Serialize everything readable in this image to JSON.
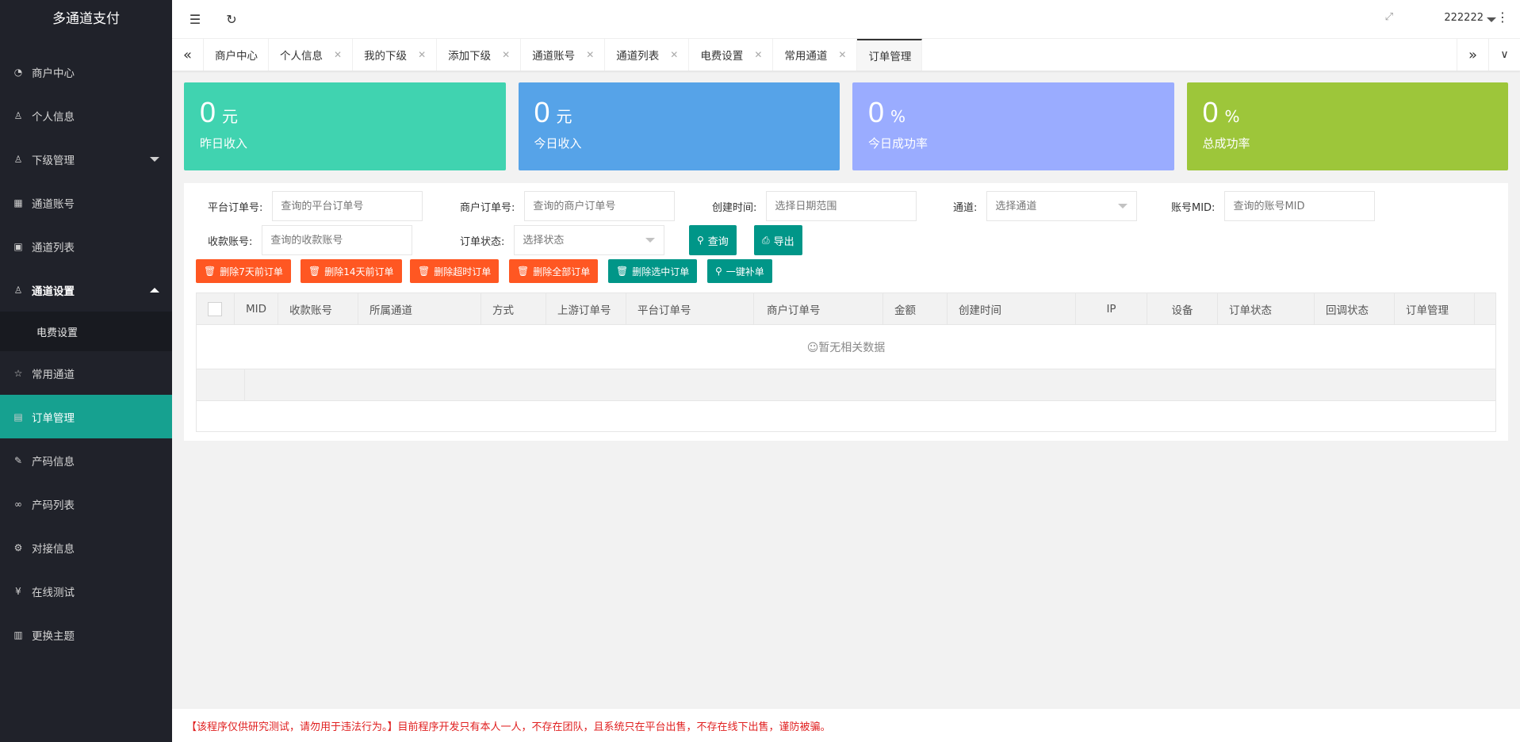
{
  "app": {
    "title": "多通道支付"
  },
  "sidebar": {
    "items": [
      {
        "label": "商户中心",
        "icon": "dashboard-icon"
      },
      {
        "label": "个人信息",
        "icon": "user-icon"
      },
      {
        "label": "下级管理",
        "icon": "users-icon"
      },
      {
        "label": "通道账号",
        "icon": "grid-icon"
      },
      {
        "label": "通道列表",
        "icon": "apps-icon"
      },
      {
        "label": "通道设置",
        "icon": "user-settings-icon"
      },
      {
        "label": "电费设置"
      },
      {
        "label": "常用通道",
        "icon": "star-icon"
      },
      {
        "label": "订单管理",
        "icon": "file-icon"
      },
      {
        "label": "产码信息",
        "icon": "edit-icon"
      },
      {
        "label": "产码列表",
        "icon": "link-icon"
      },
      {
        "label": "对接信息",
        "icon": "gear-icon"
      },
      {
        "label": "在线测试",
        "icon": "yen-icon"
      },
      {
        "label": "更换主题",
        "icon": "template-icon"
      }
    ]
  },
  "header": {
    "username": "222222"
  },
  "tabs": [
    "商户中心",
    "个人信息",
    "我的下级",
    "添加下级",
    "通道账号",
    "通道列表",
    "电费设置",
    "常用通道",
    "订单管理"
  ],
  "cards": [
    {
      "value": "0",
      "unit": "元",
      "label": "昨日收入",
      "color": "#40d3b0"
    },
    {
      "value": "0",
      "unit": "元",
      "label": "今日收入",
      "color": "#56a3e8"
    },
    {
      "value": "0",
      "unit": "%",
      "label": "今日成功率",
      "color": "#9aacff"
    },
    {
      "value": "0",
      "unit": "%",
      "label": "总成功率",
      "color": "#9dc63a"
    }
  ],
  "filters": {
    "platform_order": {
      "label": "平台订单号:",
      "placeholder": "查询的平台订单号"
    },
    "merchant_order": {
      "label": "商户订单号:",
      "placeholder": "查询的商户订单号"
    },
    "create_time": {
      "label": "创建时间:",
      "placeholder": "选择日期范围"
    },
    "channel": {
      "label": "通道:",
      "placeholder": "选择通道"
    },
    "account_mid": {
      "label": "账号MID:",
      "placeholder": "查询的账号MID"
    },
    "receive_account": {
      "label": "收款账号:",
      "placeholder": "查询的收款账号"
    },
    "order_status": {
      "label": "订单状态:",
      "placeholder": "选择状态"
    },
    "query_btn": "查询",
    "export_btn": "导出"
  },
  "actions": [
    "删除7天前订单",
    "删除14天前订单",
    "删除超时订单",
    "删除全部订单",
    "删除选中订单",
    "一键补单"
  ],
  "table": {
    "columns": [
      "MID",
      "收款账号",
      "所属通道",
      "方式",
      "上游订单号",
      "平台订单号",
      "商户订单号",
      "金额",
      "创建时间",
      "IP",
      "设备",
      "订单状态",
      "回调状态",
      "订单管理"
    ],
    "empty_text": "☺暂无相关数据"
  },
  "footer": {
    "notice": "【该程序仅供研究测试，请勿用于违法行为。】目前程序开发只有本人一人，不存在团队，且系统只在平台出售，不存在线下出售，谨防被骗。"
  }
}
